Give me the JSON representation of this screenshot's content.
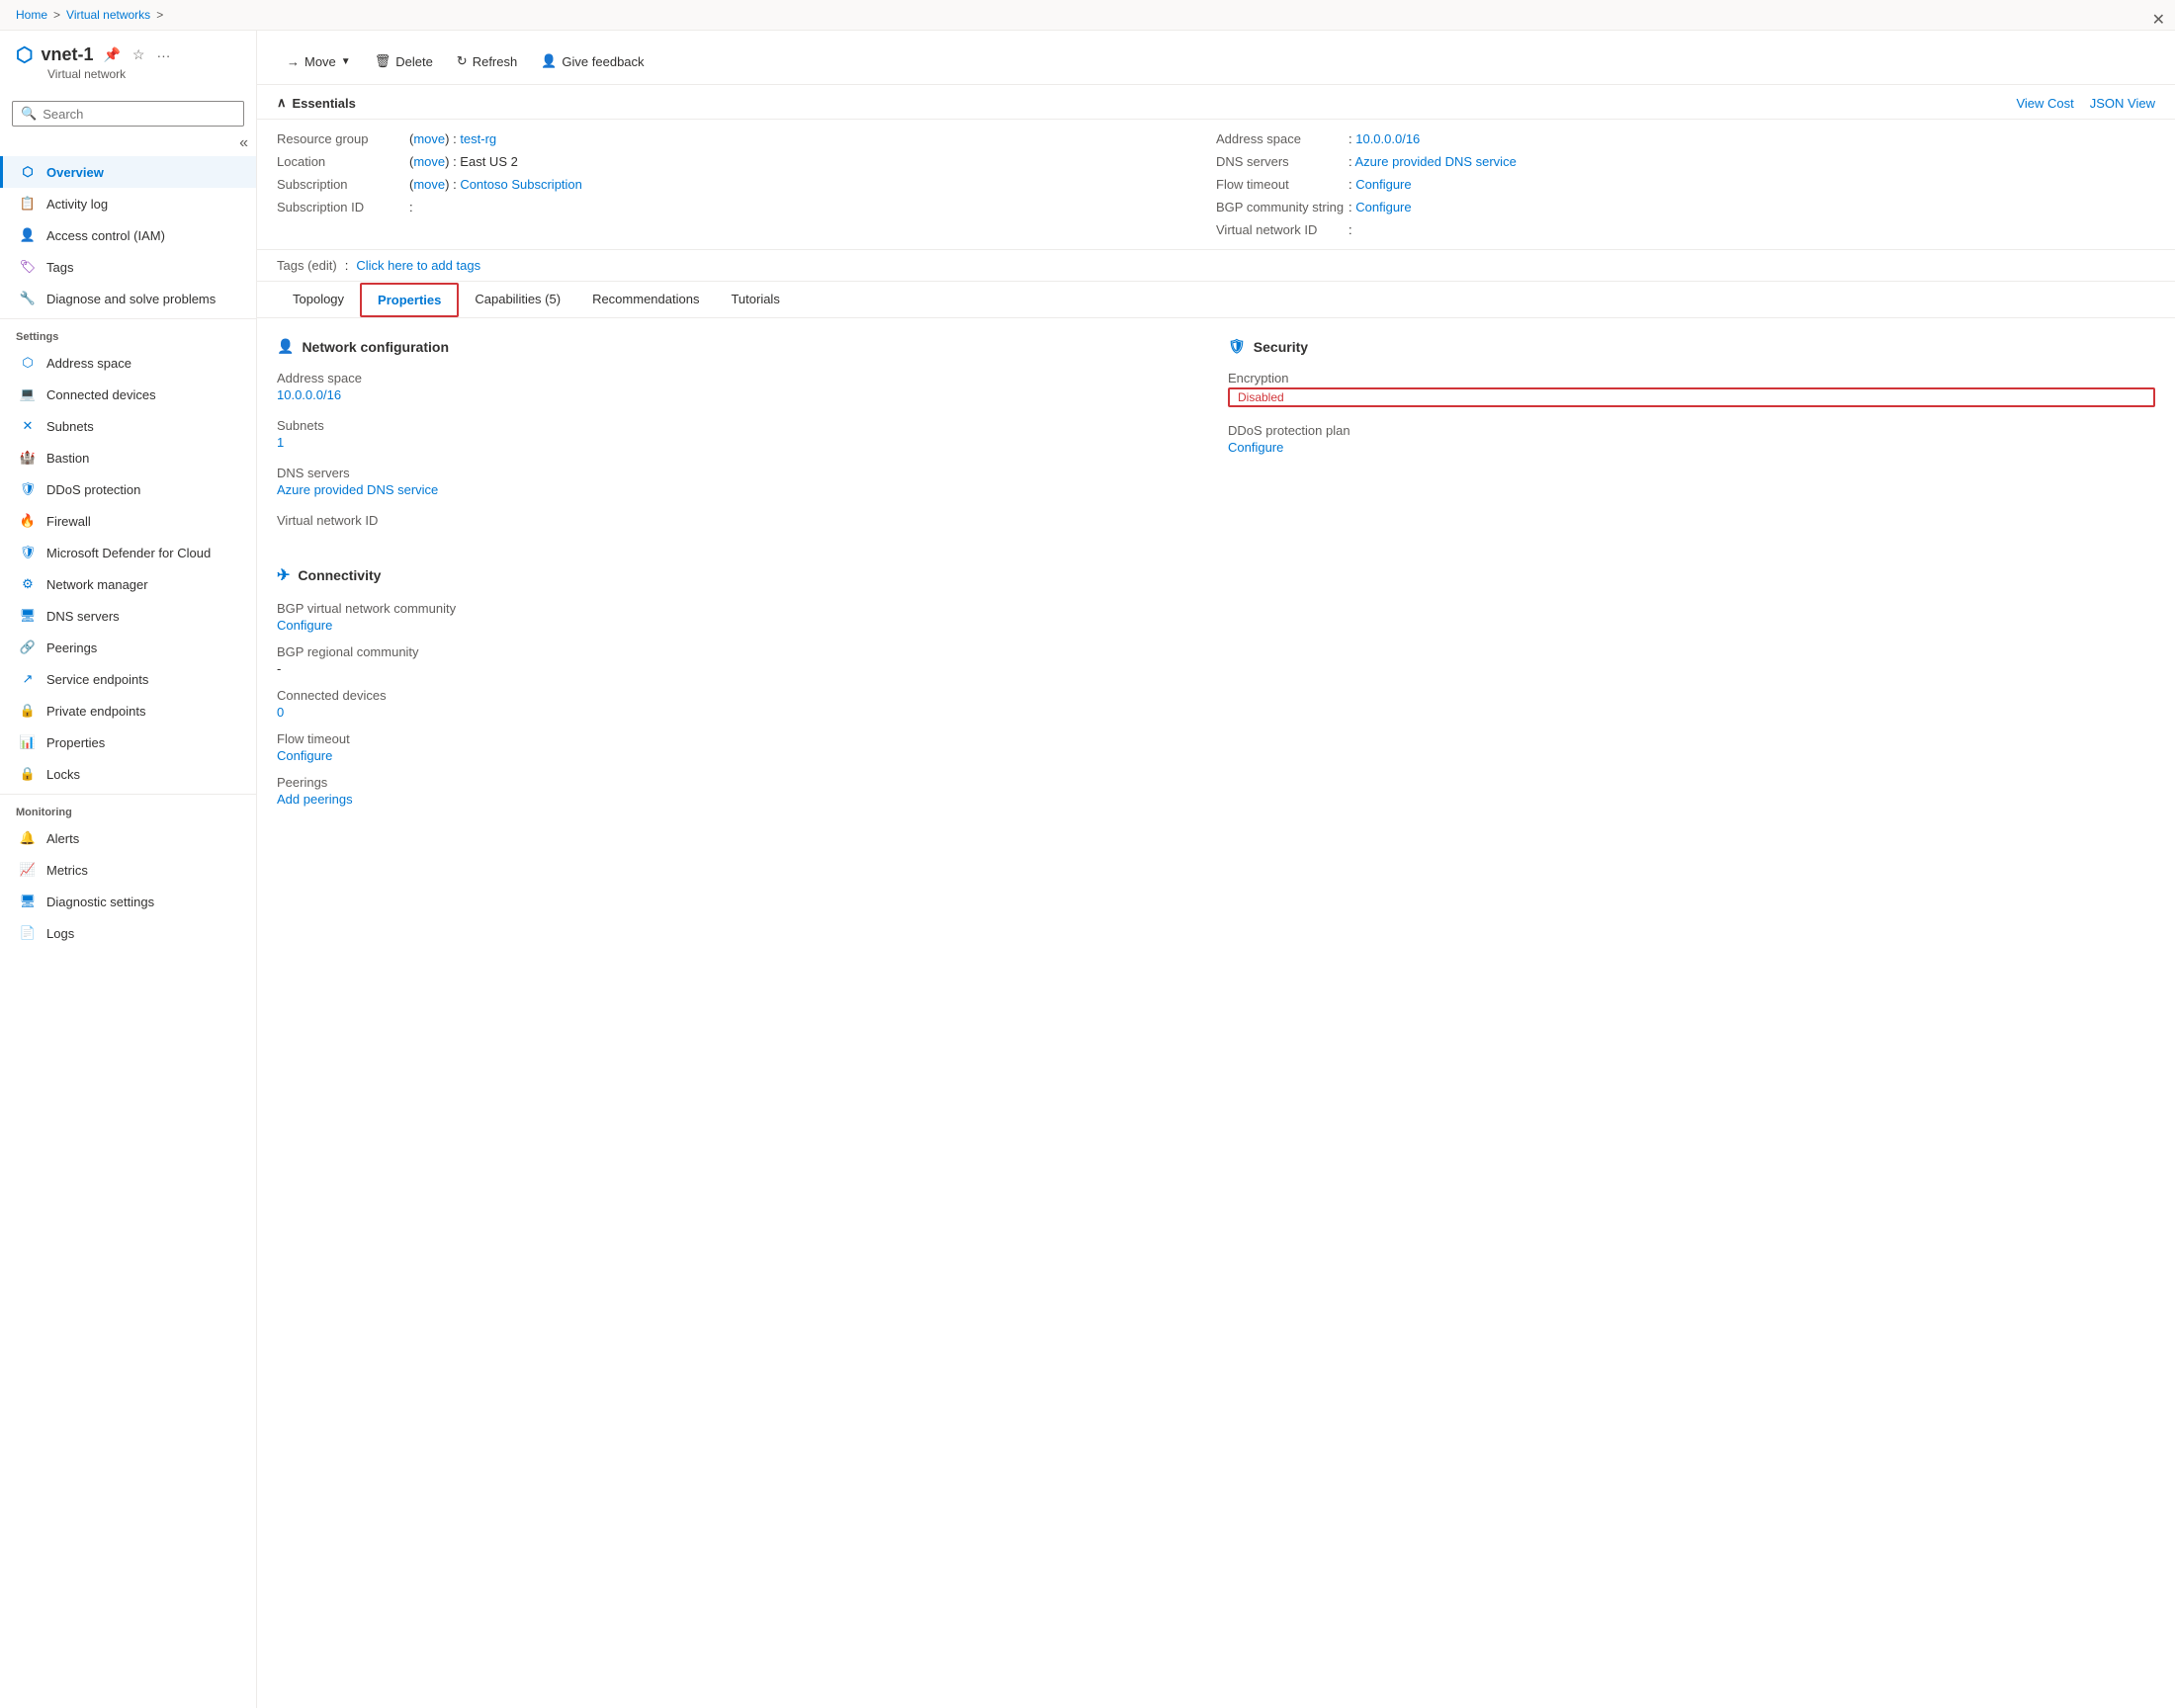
{
  "breadcrumb": {
    "home": "Home",
    "sep1": ">",
    "virtual_networks": "Virtual networks",
    "sep2": ">"
  },
  "sidebar": {
    "resource_name": "vnet-1",
    "resource_type": "Virtual network",
    "search_placeholder": "Search",
    "collapse_tooltip": "Collapse",
    "nav_items": [
      {
        "id": "overview",
        "label": "Overview",
        "active": true
      },
      {
        "id": "activity-log",
        "label": "Activity log",
        "active": false
      },
      {
        "id": "iam",
        "label": "Access control (IAM)",
        "active": false
      },
      {
        "id": "tags",
        "label": "Tags",
        "active": false
      },
      {
        "id": "diagnose",
        "label": "Diagnose and solve problems",
        "active": false
      }
    ],
    "settings_label": "Settings",
    "settings_items": [
      {
        "id": "address-space",
        "label": "Address space",
        "active": false
      },
      {
        "id": "connected-devices",
        "label": "Connected devices",
        "active": false
      },
      {
        "id": "subnets",
        "label": "Subnets",
        "active": false
      },
      {
        "id": "bastion",
        "label": "Bastion",
        "active": false
      },
      {
        "id": "ddos",
        "label": "DDoS protection",
        "active": false
      },
      {
        "id": "firewall",
        "label": "Firewall",
        "active": false
      },
      {
        "id": "defender",
        "label": "Microsoft Defender for Cloud",
        "active": false
      },
      {
        "id": "network-manager",
        "label": "Network manager",
        "active": false
      },
      {
        "id": "dns-servers",
        "label": "DNS servers",
        "active": false
      },
      {
        "id": "peerings",
        "label": "Peerings",
        "active": false
      },
      {
        "id": "service-endpoints",
        "label": "Service endpoints",
        "active": false
      },
      {
        "id": "private-endpoints",
        "label": "Private endpoints",
        "active": false
      },
      {
        "id": "properties",
        "label": "Properties",
        "active": false
      },
      {
        "id": "locks",
        "label": "Locks",
        "active": false
      }
    ],
    "monitoring_label": "Monitoring",
    "monitoring_items": [
      {
        "id": "alerts",
        "label": "Alerts",
        "active": false
      },
      {
        "id": "metrics",
        "label": "Metrics",
        "active": false
      },
      {
        "id": "diagnostic-settings",
        "label": "Diagnostic settings",
        "active": false
      },
      {
        "id": "logs",
        "label": "Logs",
        "active": false
      }
    ]
  },
  "toolbar": {
    "move_label": "Move",
    "delete_label": "Delete",
    "refresh_label": "Refresh",
    "feedback_label": "Give feedback"
  },
  "essentials": {
    "title": "Essentials",
    "view_cost": "View Cost",
    "json_view": "JSON View",
    "left_col": [
      {
        "label": "Resource group",
        "value": "test-rg",
        "prefix": "(move)",
        "separator": ":",
        "link": true,
        "move_link": true
      },
      {
        "label": "Location",
        "value": "East US 2",
        "prefix": "(move)",
        "separator": ":",
        "link": false,
        "move_link": true
      },
      {
        "label": "Subscription",
        "value": "Contoso Subscription",
        "prefix": "(move)",
        "separator": ":",
        "link": true,
        "move_link": true
      },
      {
        "label": "Subscription ID",
        "value": "",
        "separator": ":",
        "link": false
      }
    ],
    "right_col": [
      {
        "label": "Address space",
        "value": "10.0.0.0/16",
        "separator": ":",
        "link": true
      },
      {
        "label": "DNS servers",
        "value": "Azure provided DNS service",
        "separator": ":",
        "link": true
      },
      {
        "label": "Flow timeout",
        "value": "Configure",
        "separator": ":",
        "link": true
      },
      {
        "label": "BGP community string",
        "value": "Configure",
        "separator": ":",
        "link": true
      },
      {
        "label": "Virtual network ID",
        "value": "",
        "separator": ":",
        "link": false
      }
    ],
    "tags_label": "Tags (edit)",
    "tags_action": "Click here to add tags"
  },
  "tabs": [
    {
      "id": "topology",
      "label": "Topology",
      "active": false,
      "highlighted": false
    },
    {
      "id": "properties",
      "label": "Properties",
      "active": true,
      "highlighted": true
    },
    {
      "id": "capabilities",
      "label": "Capabilities (5)",
      "active": false,
      "highlighted": false
    },
    {
      "id": "recommendations",
      "label": "Recommendations",
      "active": false,
      "highlighted": false
    },
    {
      "id": "tutorials",
      "label": "Tutorials",
      "active": false,
      "highlighted": false
    }
  ],
  "network_config": {
    "section_title": "Network configuration",
    "address_space_label": "Address space",
    "address_space_value": "10.0.0.0/16",
    "subnets_label": "Subnets",
    "subnets_value": "1",
    "dns_servers_label": "DNS servers",
    "dns_servers_value": "Azure provided DNS service",
    "vnet_id_label": "Virtual network ID"
  },
  "security": {
    "section_title": "Security",
    "encryption_label": "Encryption",
    "encryption_value": "Disabled",
    "ddos_label": "DDoS protection plan",
    "ddos_value": "Configure"
  },
  "connectivity": {
    "section_title": "Connectivity",
    "bgp_community_label": "BGP virtual network community",
    "bgp_community_value": "Configure",
    "bgp_regional_label": "BGP regional community",
    "bgp_regional_value": "-",
    "connected_devices_label": "Connected devices",
    "connected_devices_value": "0",
    "flow_timeout_label": "Flow timeout",
    "flow_timeout_value": "Configure",
    "peerings_label": "Peerings",
    "peerings_value": "Add peerings"
  },
  "colors": {
    "accent": "#0078d4",
    "danger": "#d13438",
    "text_primary": "#323130",
    "text_secondary": "#605e5c",
    "bg_sidebar_active": "#eff6fc",
    "border": "#edebe9"
  }
}
